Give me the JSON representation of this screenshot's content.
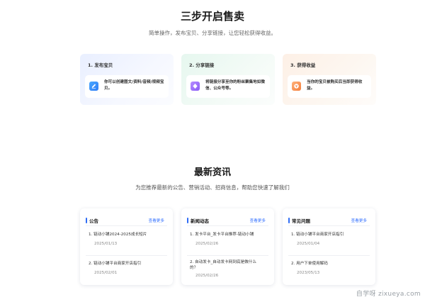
{
  "steps_section": {
    "title": "三步开启售卖",
    "subtitle": "简单操作，发布宝贝、分享链接，让您轻松获得收益。",
    "steps": [
      {
        "title": "1. 发布宝贝",
        "desc": "你可以创建图文/资料/音频/视频宝贝。",
        "icon": "edit-icon",
        "color": "#2f7df6"
      },
      {
        "title": "2. 分享链接",
        "desc": "将链接分享至你的粉丝聚集地如微信、公众号等。",
        "icon": "share-icon",
        "color": "#8a5cf6"
      },
      {
        "title": "3. 获得收益",
        "desc": "当你的宝贝被购买后当即获得收益。",
        "icon": "money-icon",
        "color": "#f47f3e"
      }
    ]
  },
  "news_section": {
    "title": "最新资讯",
    "subtitle": "为您推荐最新的公告、营销活动、招商信息，帮助您快速了解我们",
    "accent": "#2f6df6",
    "cards": [
      {
        "title": "公告",
        "more": "查看更多",
        "items": [
          {
            "text": "1.  链动小铺2024-2025成长短片",
            "date": "2025/01/13"
          },
          {
            "text": "2.  链动小铺平台商家开店指引",
            "date": "2025/02/01"
          }
        ]
      },
      {
        "title": "新闻动态",
        "more": "查看更多",
        "items": [
          {
            "text": "1.  发卡平台_发卡平台推荐-链动小铺",
            "date": "2025/02/26"
          },
          {
            "text": "2.  自动发卡_自动发卡网到底是做什么的？",
            "date": "2025/02/26"
          }
        ]
      },
      {
        "title": "常见问题",
        "more": "查看更多",
        "items": [
          {
            "text": "1.  链动小铺平台商家开店指引",
            "date": "2025/01/04"
          },
          {
            "text": "2.  用户下单使用解码",
            "date": "2023/05/13"
          }
        ]
      }
    ]
  },
  "watermark": "自学呀 zixueya.com"
}
